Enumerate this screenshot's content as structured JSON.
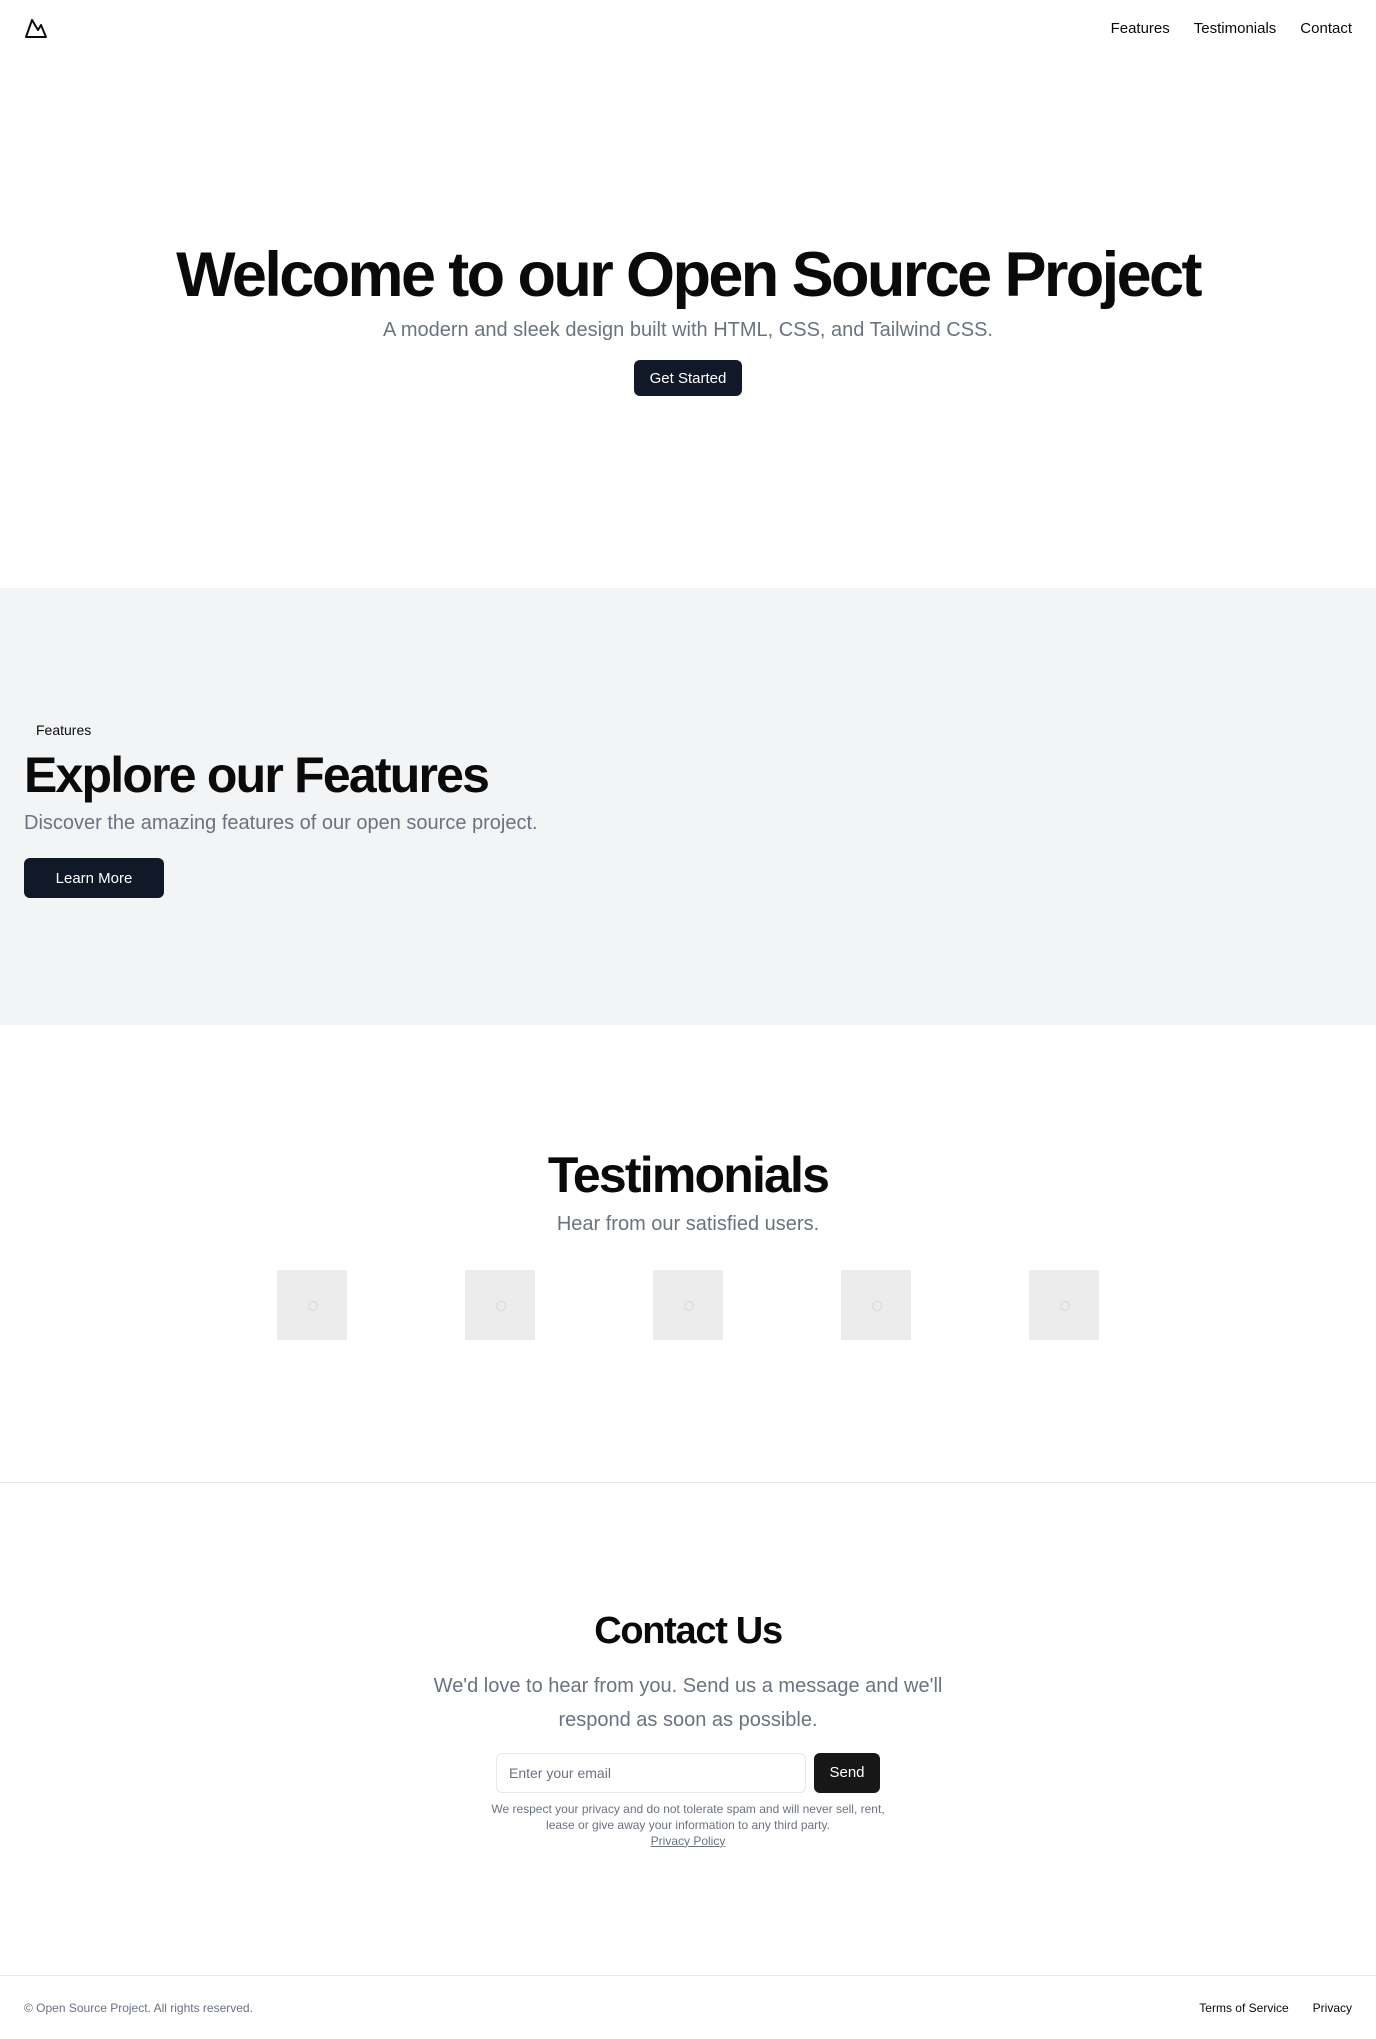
{
  "header": {
    "logo_icon": "mountain-icon",
    "nav": [
      {
        "label": "Features"
      },
      {
        "label": "Testimonials"
      },
      {
        "label": "Contact"
      }
    ]
  },
  "hero": {
    "title": "Welcome to our Open Source Project",
    "subtitle": "A modern and sleek design built with HTML, CSS, and Tailwind CSS.",
    "cta_label": "Get Started"
  },
  "features": {
    "badge": "Features",
    "title": "Explore our Features",
    "subtitle": "Discover the amazing features of our open source project.",
    "cta_label": "Learn More"
  },
  "testimonials": {
    "title": "Testimonials",
    "subtitle": "Hear from our satisfied users."
  },
  "contact": {
    "title": "Contact Us",
    "lead": "We'd love to hear from you. Send us a message and we'll respond as soon as possible.",
    "email_placeholder": "Enter your email",
    "send_label": "Send",
    "privacy_note": "We respect your privacy and do not tolerate spam and will never sell, rent, lease or give away your information to any third party.",
    "privacy_link": "Privacy Policy"
  },
  "footer": {
    "copyright": "© Open Source Project. All rights reserved.",
    "links": [
      {
        "label": "Terms of Service"
      },
      {
        "label": "Privacy"
      }
    ]
  },
  "colors": {
    "primary_button": "#111827",
    "send_button": "#171717",
    "muted_text": "#6b7280",
    "section_bg": "#f3f4f6"
  }
}
